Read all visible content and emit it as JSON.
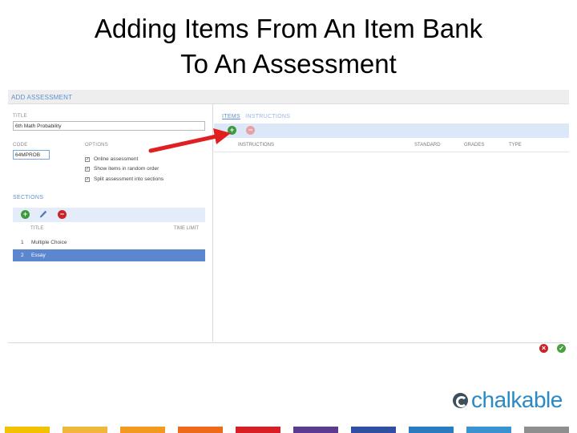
{
  "slide": {
    "title_line1": "Adding Items From An Item Bank",
    "title_line2": "To An Assessment"
  },
  "panel": {
    "header": "ADD ASSESSMENT",
    "title_label": "TITLE",
    "title_value": "6th Math Probability",
    "code_label": "CODE",
    "code_value": "64MPROB",
    "options_label": "OPTIONS",
    "options": [
      {
        "label": "Online assessment",
        "checked": true
      },
      {
        "label": "Show items in random order",
        "checked": true
      },
      {
        "label": "Split assessment into sections",
        "checked": true
      }
    ],
    "sections_label": "SECTIONS",
    "sections_columns": {
      "title": "TITLE",
      "time_limit": "TIME LIMIT"
    },
    "sections": [
      {
        "num": "1",
        "title": "Multiple Choice",
        "selected": false
      },
      {
        "num": "2",
        "title": "Essay",
        "selected": true
      }
    ],
    "tabs": {
      "items": "ITEMS",
      "instructions": "INSTRUCTIONS"
    },
    "items_columns": {
      "instructions": "INSTRUCTIONS",
      "standard": "STANDARD",
      "grades": "GRADES",
      "type": "TYPE"
    }
  },
  "icons": {
    "add": "plus-circle-icon",
    "edit": "pencil-icon",
    "remove": "minus-circle-icon",
    "cancel": "x-circle-icon",
    "confirm": "check-circle-icon",
    "arrow": "red-arrow-annotation"
  },
  "logo": {
    "text": "chalkable"
  },
  "colors": {
    "accent": "#5e8fd0",
    "selected_row": "#5b87cf",
    "add": "#3c9b3c",
    "remove": "#c8242a",
    "arrow": "#e02020",
    "logo": "#2b8ac4",
    "bar": [
      "#f2c200",
      "#f0b83a",
      "#f39a1e",
      "#ee6a1a",
      "#d81f26",
      "#5a3b8e",
      "#2f4fa3",
      "#2b7bc1",
      "#3a92d0",
      "#8e8e8e"
    ]
  }
}
